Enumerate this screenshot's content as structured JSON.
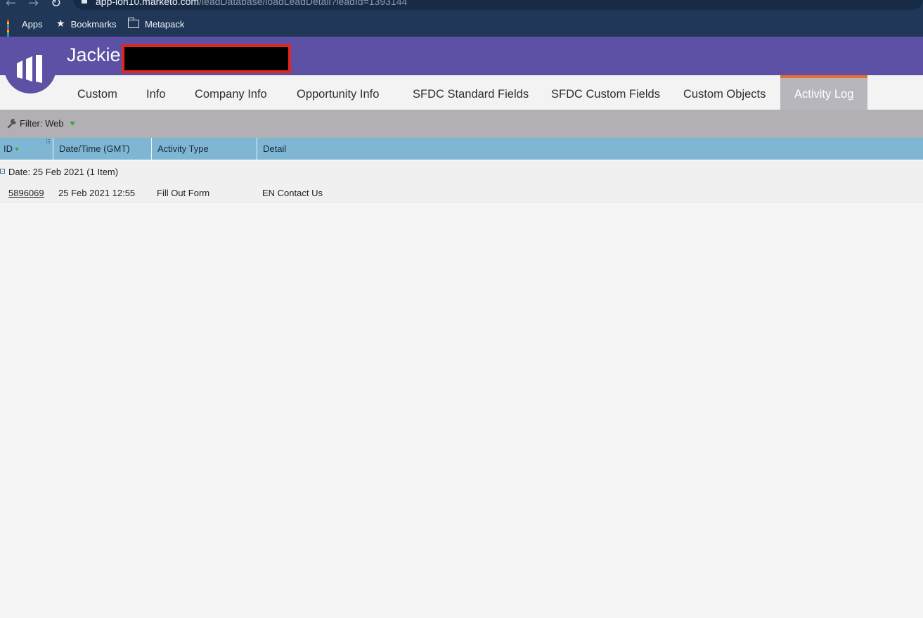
{
  "browser": {
    "url_host": "app-lon10.marketo.com",
    "url_path": "/leadDatabase/loadLeadDetail?leadId=1393144",
    "bookmarks": [
      {
        "label": "Apps",
        "icon": "apps-grid-icon"
      },
      {
        "label": "Bookmarks",
        "icon": "star-icon"
      },
      {
        "label": "Metapack",
        "icon": "folder-icon"
      }
    ]
  },
  "header": {
    "lead_name": "Jackie",
    "logo": "marketo-logo",
    "brand_color": "#5d51a5"
  },
  "tabs": [
    {
      "label": "Custom"
    },
    {
      "label": "Info"
    },
    {
      "label": "Company Info"
    },
    {
      "label": "Opportunity Info"
    },
    {
      "label": "SFDC Standard Fields"
    },
    {
      "label": "SFDC Custom Fields"
    },
    {
      "label": "Custom Objects"
    },
    {
      "label": "Activity Log",
      "active": true
    }
  ],
  "filter": {
    "label": "Filter: Web",
    "icon": "wrench-icon"
  },
  "grid": {
    "columns": [
      "ID",
      "Date/Time (GMT)",
      "Activity Type",
      "Detail"
    ],
    "group_label": "Date: 25 Feb 2021 (1 Item)",
    "rows": [
      {
        "id": "5896069",
        "datetime": "25 Feb 2021 12:55",
        "activity_type": "Fill Out Form",
        "detail": "EN Contact Us"
      }
    ]
  },
  "colors": {
    "accent_tab": "#e8702f",
    "grid_header": "#7eb6d4",
    "redaction_border": "#e3261b"
  }
}
